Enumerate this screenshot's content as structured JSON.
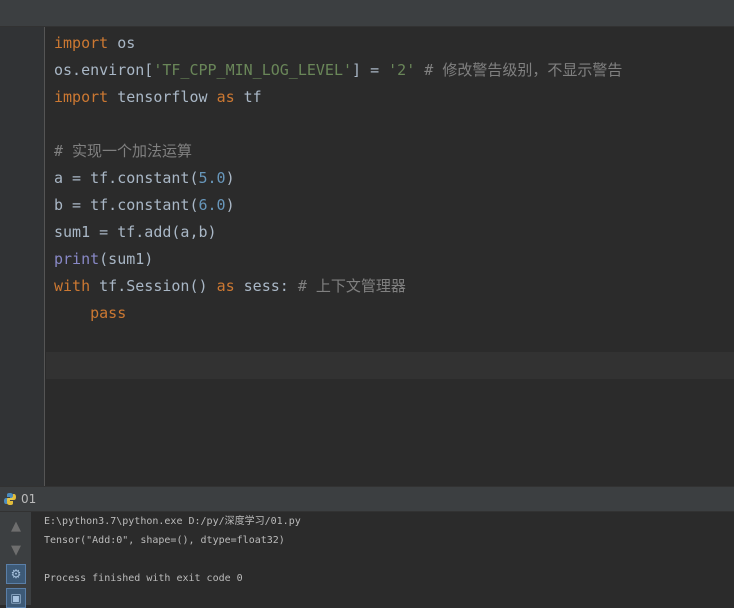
{
  "editor": {
    "lines": [
      {
        "tokens": [
          {
            "t": "import",
            "c": "kw"
          },
          {
            "t": " os",
            "c": ""
          }
        ]
      },
      {
        "tokens": [
          {
            "t": "os.environ[",
            "c": ""
          },
          {
            "t": "'TF_CPP_MIN_LOG_LEVEL'",
            "c": "str"
          },
          {
            "t": "] = ",
            "c": ""
          },
          {
            "t": "'2'",
            "c": "str"
          },
          {
            "t": " # 修改警告级别，不显示警告",
            "c": "cmt"
          }
        ]
      },
      {
        "tokens": [
          {
            "t": "import",
            "c": "kw"
          },
          {
            "t": " tensorflow ",
            "c": ""
          },
          {
            "t": "as",
            "c": "kw"
          },
          {
            "t": " tf",
            "c": ""
          }
        ]
      },
      {
        "tokens": []
      },
      {
        "tokens": [
          {
            "t": "# 实现一个加法运算",
            "c": "cmt"
          }
        ]
      },
      {
        "tokens": [
          {
            "t": "a = tf.constant(",
            "c": ""
          },
          {
            "t": "5.0",
            "c": "num"
          },
          {
            "t": ")",
            "c": ""
          }
        ]
      },
      {
        "tokens": [
          {
            "t": "b = tf.constant(",
            "c": ""
          },
          {
            "t": "6.0",
            "c": "num"
          },
          {
            "t": ")",
            "c": ""
          }
        ]
      },
      {
        "tokens": [
          {
            "t": "sum1 = tf.add(a,b)",
            "c": ""
          }
        ]
      },
      {
        "tokens": [
          {
            "t": "print",
            "c": "bi"
          },
          {
            "t": "(sum1)",
            "c": ""
          }
        ]
      },
      {
        "tokens": [
          {
            "t": "with",
            "c": "kw"
          },
          {
            "t": " tf.Session() ",
            "c": ""
          },
          {
            "t": "as",
            "c": "kw"
          },
          {
            "t": " sess: ",
            "c": ""
          },
          {
            "t": "# 上下文管理器",
            "c": "cmt"
          }
        ]
      },
      {
        "tokens": [
          {
            "t": "    ",
            "c": ""
          },
          {
            "t": "pass",
            "c": "kw"
          }
        ]
      }
    ]
  },
  "run_panel": {
    "tab_label": "01",
    "tab_icon": "python-icon",
    "toolbar": [
      {
        "name": "rerun-up-icon",
        "glyph": "▲"
      },
      {
        "name": "scroll-down-icon",
        "glyph": "▼"
      },
      {
        "name": "settings-icon",
        "glyph": "⚙"
      },
      {
        "name": "pin-icon",
        "glyph": "▣"
      }
    ],
    "console_lines": [
      "E:\\python3.7\\python.exe D:/py/深度学习/01.py",
      "Tensor(\"Add:0\", shape=(), dtype=float32)",
      "",
      "Process finished with exit code 0"
    ]
  },
  "colors": {
    "keyword": "#cc7832",
    "string": "#6a8759",
    "number": "#6897bb",
    "comment": "#808080",
    "builtin": "#8888c6",
    "text": "#a9b7c6",
    "background": "#2b2b2b"
  }
}
